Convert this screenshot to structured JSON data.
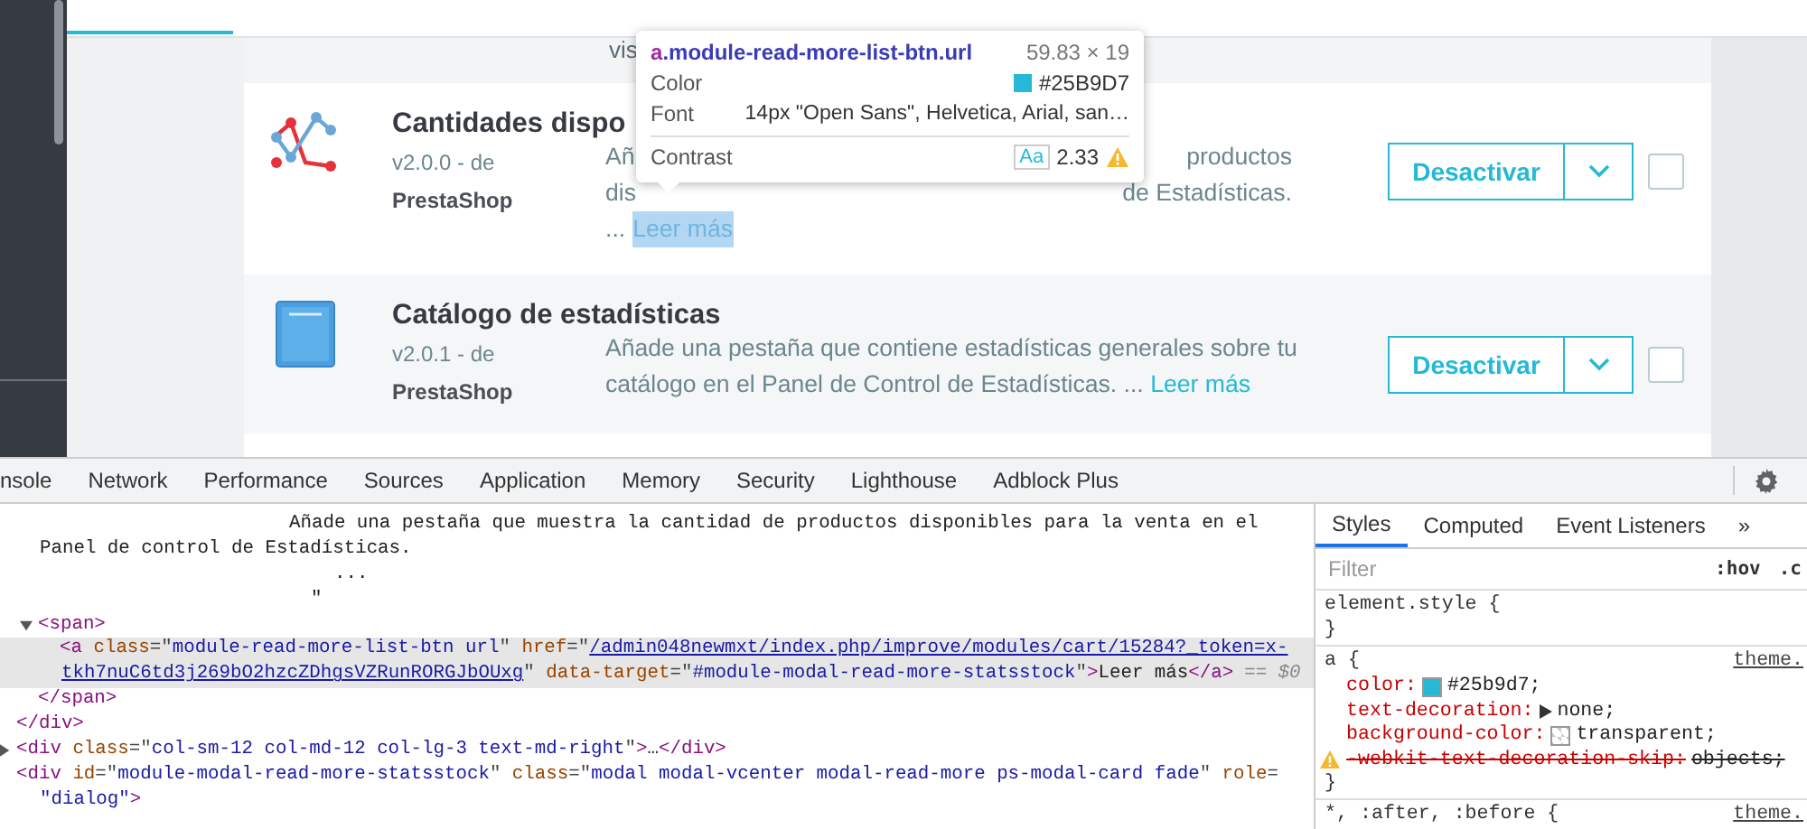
{
  "page": {
    "partial_text": "vis",
    "modules": [
      {
        "kind": "covered",
        "name": "Cantidades dispo",
        "version": "v2.0.0 - de",
        "author": "PrestaShop",
        "description_parts": [
          [
            "Añ",
            "productos"
          ],
          [
            "dis",
            "de Estadísticas."
          ]
        ],
        "ellipsis": "...",
        "read_more": "Leer más",
        "read_more_highlighted": true,
        "button": "Desactivar",
        "checked": false
      },
      {
        "kind": "plain",
        "name": "Catálogo de estadísticas",
        "version": "v2.0.1 - de",
        "author": "PrestaShop",
        "description": "Añade una pestaña que contiene estadísticas generales sobre tu catálogo en el Panel de Control de Estadísticas. ...",
        "read_more": "Leer más",
        "read_more_highlighted": false,
        "button": "Desactivar",
        "checked": false
      }
    ]
  },
  "tooltip": {
    "tag": "a",
    "class_name": ".module-read-more-list-btn.url",
    "size": "59.83 × 19",
    "color_label": "Color",
    "color_value": "#25B9D7",
    "color": "#25b9d7",
    "font_label": "Font",
    "font_value": "14px \"Open Sans\", Helvetica, Arial, san…",
    "contrast_label": "Contrast",
    "contrast_sample": "Aa",
    "contrast_value": "2.33",
    "contrast_warning": true
  },
  "devtools": {
    "tabs": [
      {
        "label": "nsole",
        "selected": false
      },
      {
        "label": "Network",
        "selected": false
      },
      {
        "label": "Performance",
        "selected": false
      },
      {
        "label": "Sources",
        "selected": false
      },
      {
        "label": "Application",
        "selected": false
      },
      {
        "label": "Memory",
        "selected": false
      },
      {
        "label": "Security",
        "selected": false
      },
      {
        "label": "Lighthouse",
        "selected": false
      },
      {
        "label": "Adblock Plus",
        "selected": false
      }
    ],
    "elements": [
      {
        "kind": "group",
        "children": [
          {
            "kind": "text",
            "lines": [
              {
                "kind": "start",
                "text": "Añade una pestaña que muestra la cantidad de productos disponibles para la venta en el"
              },
              {
                "kind": "wrap",
                "text": "Panel de control de Estadísticas."
              },
              {
                "kind": "ellipsis",
                "text": "..."
              },
              {
                "kind": "quote",
                "text": "\""
              }
            ]
          },
          {
            "kind": "tag",
            "selected": false,
            "expanded": true,
            "lines": [
              [
                {
                  "kind": "tag",
                  "s": "<span>"
                }
              ]
            ],
            "children": [
              {
                "kind": "tag",
                "selected": true,
                "lines": [
                  [
                    {
                      "kind": "tag",
                      "s": "<a"
                    },
                    {
                      "kind": "attr",
                      "s": " class"
                    },
                    {
                      "kind": "punct",
                      "s": "=\""
                    },
                    {
                      "kind": "value",
                      "s": "module-read-more-list-btn url"
                    },
                    {
                      "kind": "punct",
                      "s": "\""
                    },
                    {
                      "kind": "attr",
                      "s": " href"
                    },
                    {
                      "kind": "punct",
                      "s": "=\""
                    },
                    {
                      "kind": "link",
                      "s": "/admin048newmxt/index.php/improve/modules/cart/15284?_token=x-"
                    }
                  ],
                  [
                    {
                      "kind": "link",
                      "s": "tkh7nuC6td3j269bO2hzcZDhgsVZRunRORGJbOUxg"
                    },
                    {
                      "kind": "punct",
                      "s": "\""
                    },
                    {
                      "kind": "attr",
                      "s": " data-target"
                    },
                    {
                      "kind": "punct",
                      "s": "=\""
                    },
                    {
                      "kind": "value",
                      "s": "#module-modal-read-more-statsstock"
                    },
                    {
                      "kind": "punct",
                      "s": "\""
                    },
                    {
                      "kind": "tag",
                      "s": ">"
                    },
                    {
                      "kind": "text",
                      "s": "Leer más"
                    },
                    {
                      "kind": "tag",
                      "s": "</a>"
                    }
                  ]
                ],
                "suffix": "== $0"
              }
            ],
            "close": [
              {
                "kind": "tag",
                "s": "</span>"
              }
            ]
          }
        ],
        "close": [
          {
            "kind": "tag",
            "s": "</div>"
          }
        ]
      },
      {
        "kind": "tag",
        "selected": false,
        "expanded": false,
        "lines": [
          [
            {
              "kind": "tag",
              "s": "<div"
            },
            {
              "kind": "attr",
              "s": " class"
            },
            {
              "kind": "punct",
              "s": "=\""
            },
            {
              "kind": "value",
              "s": "col-sm-12 col-md-12 col-lg-3 text-md-right"
            },
            {
              "kind": "punct",
              "s": "\""
            },
            {
              "kind": "tag",
              "s": ">"
            },
            {
              "kind": "text",
              "s": "…"
            },
            {
              "kind": "tag",
              "s": "</div>"
            }
          ]
        ]
      },
      {
        "kind": "tag",
        "selected": false,
        "lines": [
          [
            {
              "kind": "tag",
              "s": "<div"
            },
            {
              "kind": "attr",
              "s": " id"
            },
            {
              "kind": "punct",
              "s": "=\""
            },
            {
              "kind": "value",
              "s": "module-modal-read-more-statsstock"
            },
            {
              "kind": "punct",
              "s": "\""
            },
            {
              "kind": "attr",
              "s": " class"
            },
            {
              "kind": "punct",
              "s": "=\""
            },
            {
              "kind": "value",
              "s": "modal modal-vcenter modal-read-more ps-modal-card fade"
            },
            {
              "kind": "punct",
              "s": "\""
            },
            {
              "kind": "attr",
              "s": " role"
            },
            {
              "kind": "punct",
              "s": "="
            }
          ],
          [
            {
              "kind": "value",
              "s": "\"dialog\""
            },
            {
              "kind": "tag",
              "s": ">"
            }
          ]
        ]
      }
    ],
    "styles": {
      "tabs": [
        {
          "label": "Styles",
          "selected": true
        },
        {
          "label": "Computed",
          "selected": false
        },
        {
          "label": "Event Listeners",
          "selected": false
        },
        {
          "label": "»",
          "selected": false
        }
      ],
      "filter_placeholder": "Filter",
      "hov": ":hov",
      "cls": ".c",
      "rules": [
        {
          "selector": "element.style {",
          "close": "}"
        },
        {
          "selector": "a {",
          "source": "theme.",
          "close": "}",
          "declarations": [
            {
              "kind": "color",
              "property": "color:",
              "value": "#25b9d7;",
              "color": "#25b9d7",
              "overridden": false
            },
            {
              "kind": "expand",
              "property": "text-decoration:",
              "value": "none;",
              "overridden": false
            },
            {
              "kind": "checker",
              "property": "background-color:",
              "value": "transparent;",
              "overridden": false
            },
            {
              "kind": "plain",
              "property": "-webkit-text-decoration-skip:",
              "value": "objects;",
              "overridden": true
            }
          ]
        },
        {
          "selector": "*, :after, :before {",
          "source": "theme."
        }
      ]
    }
  }
}
